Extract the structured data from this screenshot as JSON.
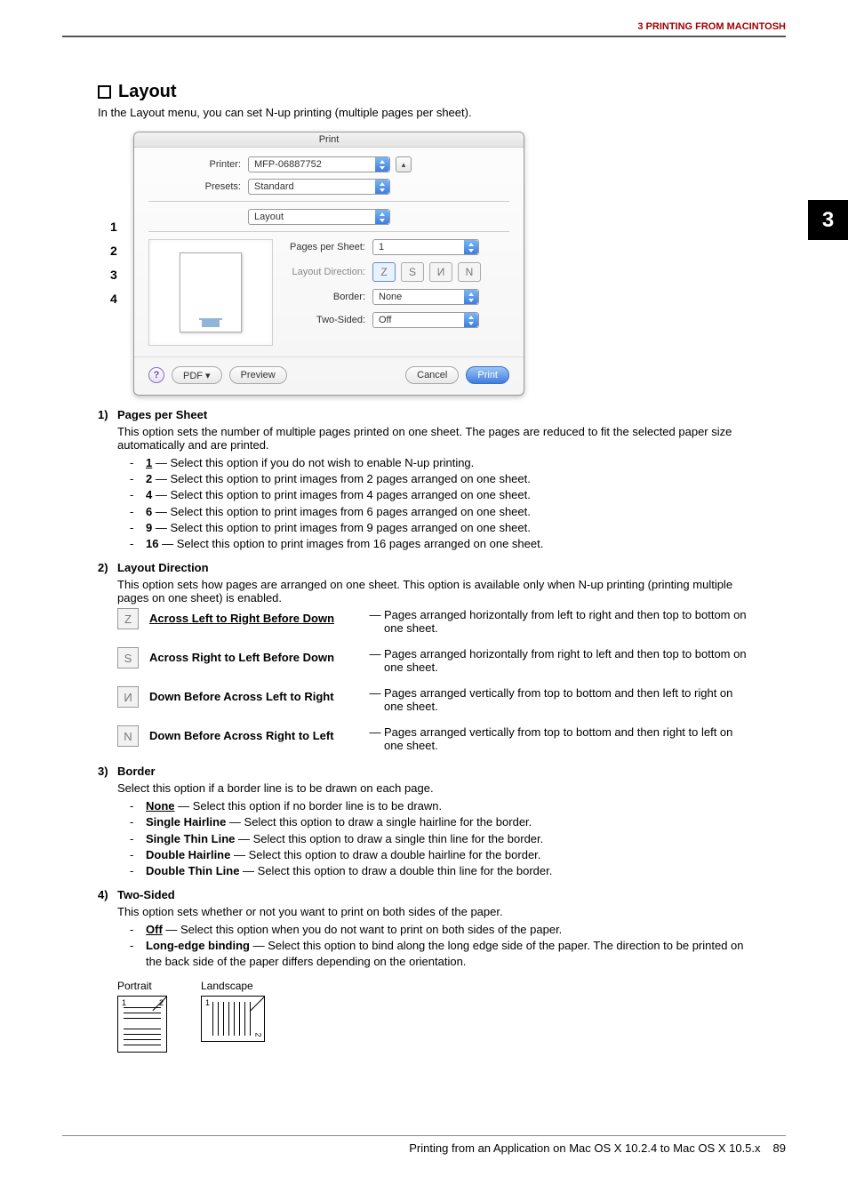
{
  "header": {
    "breadcrumb": "3 PRINTING FROM MACINTOSH"
  },
  "sideTab": "3",
  "title": "Layout",
  "intro": "In the Layout menu, you can set N-up printing (multiple pages per sheet).",
  "dialog": {
    "title": "Print",
    "printerLabel": "Printer:",
    "printerValue": "MFP-06887752",
    "presetsLabel": "Presets:",
    "presetsValue": "Standard",
    "panelValue": "Layout",
    "pagesLabel": "Pages per Sheet:",
    "pagesValue": "1",
    "dirLabel": "Layout Direction:",
    "borderLabel": "Border:",
    "borderValue": "None",
    "twoLabel": "Two-Sided:",
    "twoValue": "Off",
    "helpLabel": "?",
    "pdfLabel": "PDF ▾",
    "previewLabel": "Preview",
    "cancelLabel": "Cancel",
    "printLabel": "Print"
  },
  "callouts": [
    "1",
    "2",
    "3",
    "4"
  ],
  "s1": {
    "num": "1)",
    "title": "Pages per Sheet",
    "desc": "This option sets the number of multiple pages printed on one sheet. The pages are reduced to fit the selected paper size automatically and are printed.",
    "items": [
      {
        "k": "1",
        "u": true,
        "t": " — Select this option if you do not wish to enable N-up printing."
      },
      {
        "k": "2",
        "u": false,
        "t": " — Select this option to print images from 2 pages arranged on one sheet."
      },
      {
        "k": "4",
        "u": false,
        "t": " — Select this option to print images from 4 pages arranged on one sheet."
      },
      {
        "k": "6",
        "u": false,
        "t": " — Select this option to print images from 6 pages arranged on one sheet."
      },
      {
        "k": "9",
        "u": false,
        "t": " — Select this option to print images from 9 pages arranged on one sheet."
      },
      {
        "k": "16",
        "u": false,
        "t": " — Select this option to print images from 16 pages arranged on one sheet."
      }
    ]
  },
  "s2": {
    "num": "2)",
    "title": "Layout Direction",
    "desc": "This option sets how pages are arranged on one sheet. This option is available only when N-up printing (printing multiple pages on one sheet) is enabled.",
    "rows": [
      {
        "icon": "Z",
        "name": "Across Left to Right Before Down",
        "u": true,
        "desc": "Pages arranged horizontally from left to right and then top to bottom on one sheet."
      },
      {
        "icon": "S",
        "name": "Across Right to Left Before Down",
        "u": false,
        "desc": "Pages arranged horizontally from right to left and then top to bottom on one sheet."
      },
      {
        "icon": "И",
        "name": "Down Before Across Left to Right",
        "u": false,
        "desc": "Pages arranged vertically from top to bottom and then left to right on one sheet."
      },
      {
        "icon": "N",
        "name": "Down Before Across Right to Left",
        "u": false,
        "desc": "Pages arranged vertically from top to bottom and then right to left on one sheet."
      }
    ]
  },
  "s3": {
    "num": "3)",
    "title": "Border",
    "desc": "Select this option if a border line is to be drawn on each page.",
    "items": [
      {
        "k": "None",
        "u": true,
        "t": " — Select this option if no border line is to be drawn."
      },
      {
        "k": "Single Hairline",
        "u": false,
        "t": " — Select this option to draw a single hairline for the border."
      },
      {
        "k": "Single Thin Line",
        "u": false,
        "t": " — Select this option to draw a single thin line for the border."
      },
      {
        "k": "Double Hairline",
        "u": false,
        "t": " — Select this option to draw a double hairline for the border."
      },
      {
        "k": "Double Thin Line",
        "u": false,
        "t": " — Select this option to draw a double thin line for the border."
      }
    ]
  },
  "s4": {
    "num": "4)",
    "title": "Two-Sided",
    "desc": "This option sets whether or not you want to print on both sides of the paper.",
    "items": [
      {
        "k": "Off",
        "u": true,
        "t": " — Select this option when you do not want to print on both sides of the paper."
      },
      {
        "k": "Long-edge binding",
        "u": false,
        "t": " — Select this option to bind along the long edge side of the paper. The direction to be printed on the back side of the paper differs depending on the orientation."
      }
    ],
    "orient": {
      "portrait": "Portrait",
      "landscape": "Landscape"
    }
  },
  "footer": {
    "text": "Printing from an Application on Mac OS X 10.2.4 to Mac OS X 10.5.x",
    "page": "89"
  }
}
